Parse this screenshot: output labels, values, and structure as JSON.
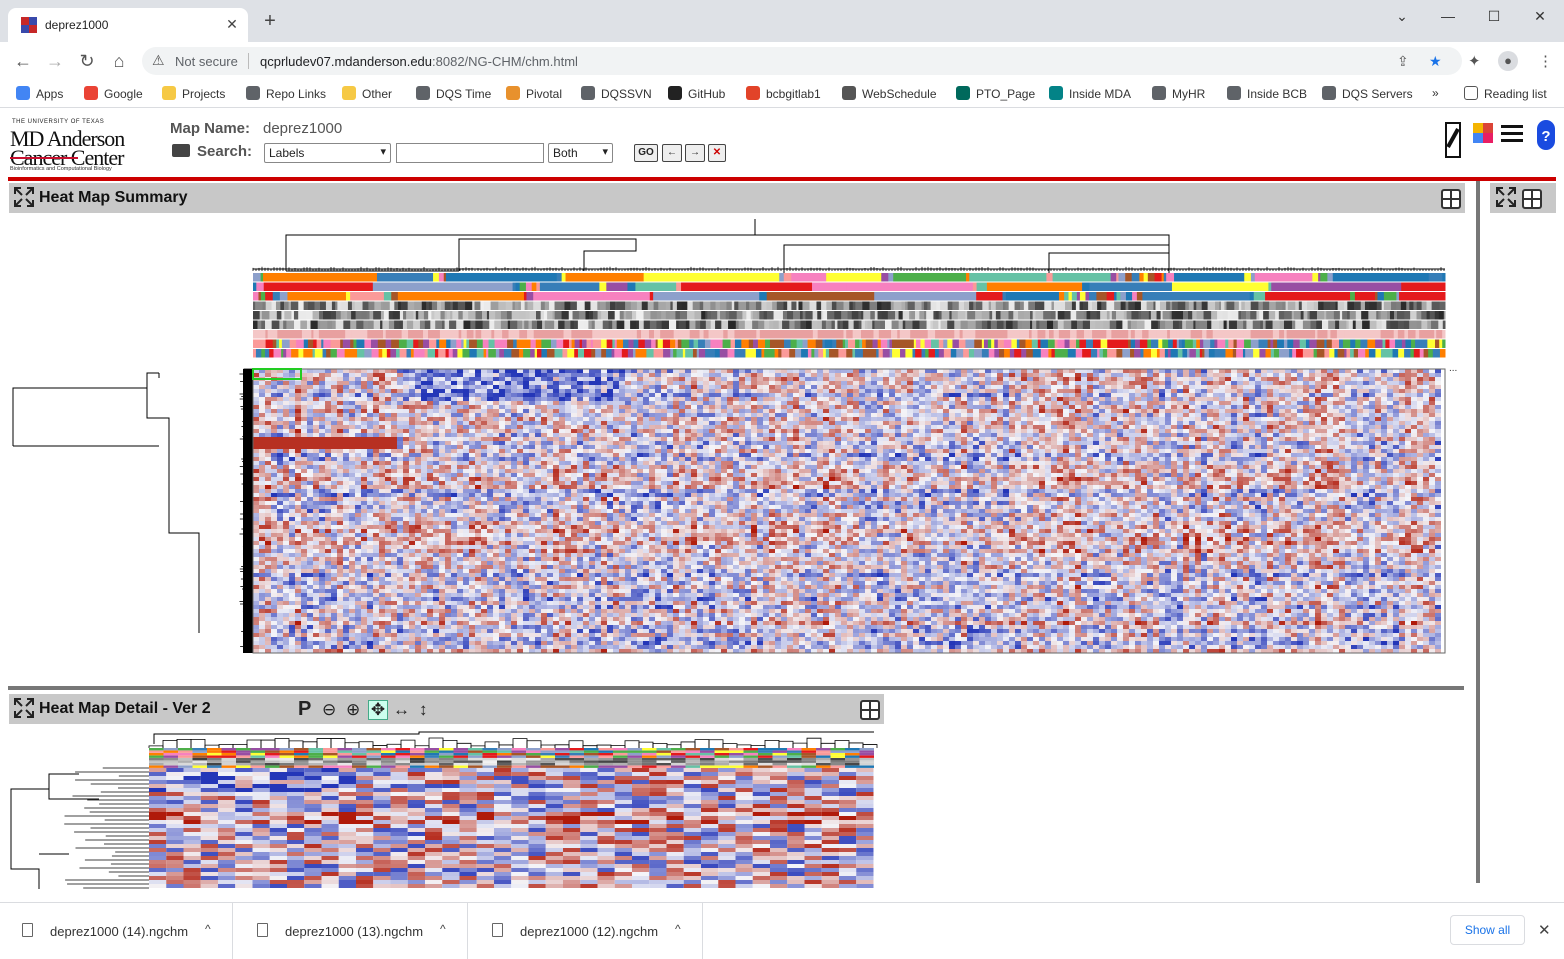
{
  "browser": {
    "tab_title": "deprez1000",
    "not_secure": "Not secure",
    "url_host": "qcprludev07.mdanderson.edu",
    "url_path": ":8082/NG-CHM/chm.html",
    "bookmarks": [
      {
        "label": "Apps",
        "icon": "apps-grid-icon",
        "color": "#4285f4"
      },
      {
        "label": "Google",
        "icon": "google-icon",
        "color": "#ea4335"
      },
      {
        "label": "Projects",
        "icon": "folder-icon",
        "color": "#f6c945"
      },
      {
        "label": "Repo Links",
        "icon": "globe-icon",
        "color": "#5f6368"
      },
      {
        "label": "Other",
        "icon": "folder-icon",
        "color": "#f6c945"
      },
      {
        "label": "DQS Time",
        "icon": "globe-icon",
        "color": "#5f6368"
      },
      {
        "label": "Pivotal",
        "icon": "pivotal-icon",
        "color": "#e8912d"
      },
      {
        "label": "DQSSVN",
        "icon": "globe-icon",
        "color": "#5f6368"
      },
      {
        "label": "GitHub",
        "icon": "github-icon",
        "color": "#222222"
      },
      {
        "label": "bcbgitlab1",
        "icon": "gitlab-icon",
        "color": "#e24329"
      },
      {
        "label": "WebSchedule",
        "icon": "webschedule-icon",
        "color": "#555555"
      },
      {
        "label": "PTO_Page",
        "icon": "pto-icon",
        "color": "#00695c"
      },
      {
        "label": "Inside MDA",
        "icon": "sharepoint-icon",
        "color": "#038387"
      },
      {
        "label": "MyHR",
        "icon": "globe-icon",
        "color": "#5f6368"
      },
      {
        "label": "Inside BCB",
        "icon": "globe-icon",
        "color": "#5f6368"
      },
      {
        "label": "DQS Servers",
        "icon": "globe-icon",
        "color": "#5f6368"
      }
    ],
    "more_bookmarks": "»",
    "reading_list": "Reading list"
  },
  "header": {
    "logo_line1": "THE UNIVERSITY OF TEXAS",
    "logo_line2": "MD Anderson",
    "logo_line3": "Cancer Center",
    "logo_line4": "Bioinformatics and Computational Biology",
    "map_name_label": "Map Name:",
    "map_name_value": "deprez1000",
    "search_label": "Search:",
    "search_type": "Labels",
    "search_axis": "Both",
    "go_label": "GO"
  },
  "summary": {
    "title": "Heat Map Summary"
  },
  "detail": {
    "title": "Heat Map Detail - Ver 2",
    "tool_p": "P"
  },
  "downloads": {
    "files": [
      "deprez1000 (14).ngchm",
      "deprez1000 (13).ngchm",
      "deprez1000 (12).ngchm"
    ],
    "show_all": "Show all"
  },
  "colors": {
    "accent_red": "#cc0000",
    "heat_low": "#2436b8",
    "heat_mid": "#f4f4f8",
    "heat_high": "#b01a0a",
    "selection_box": "#22cc22"
  }
}
